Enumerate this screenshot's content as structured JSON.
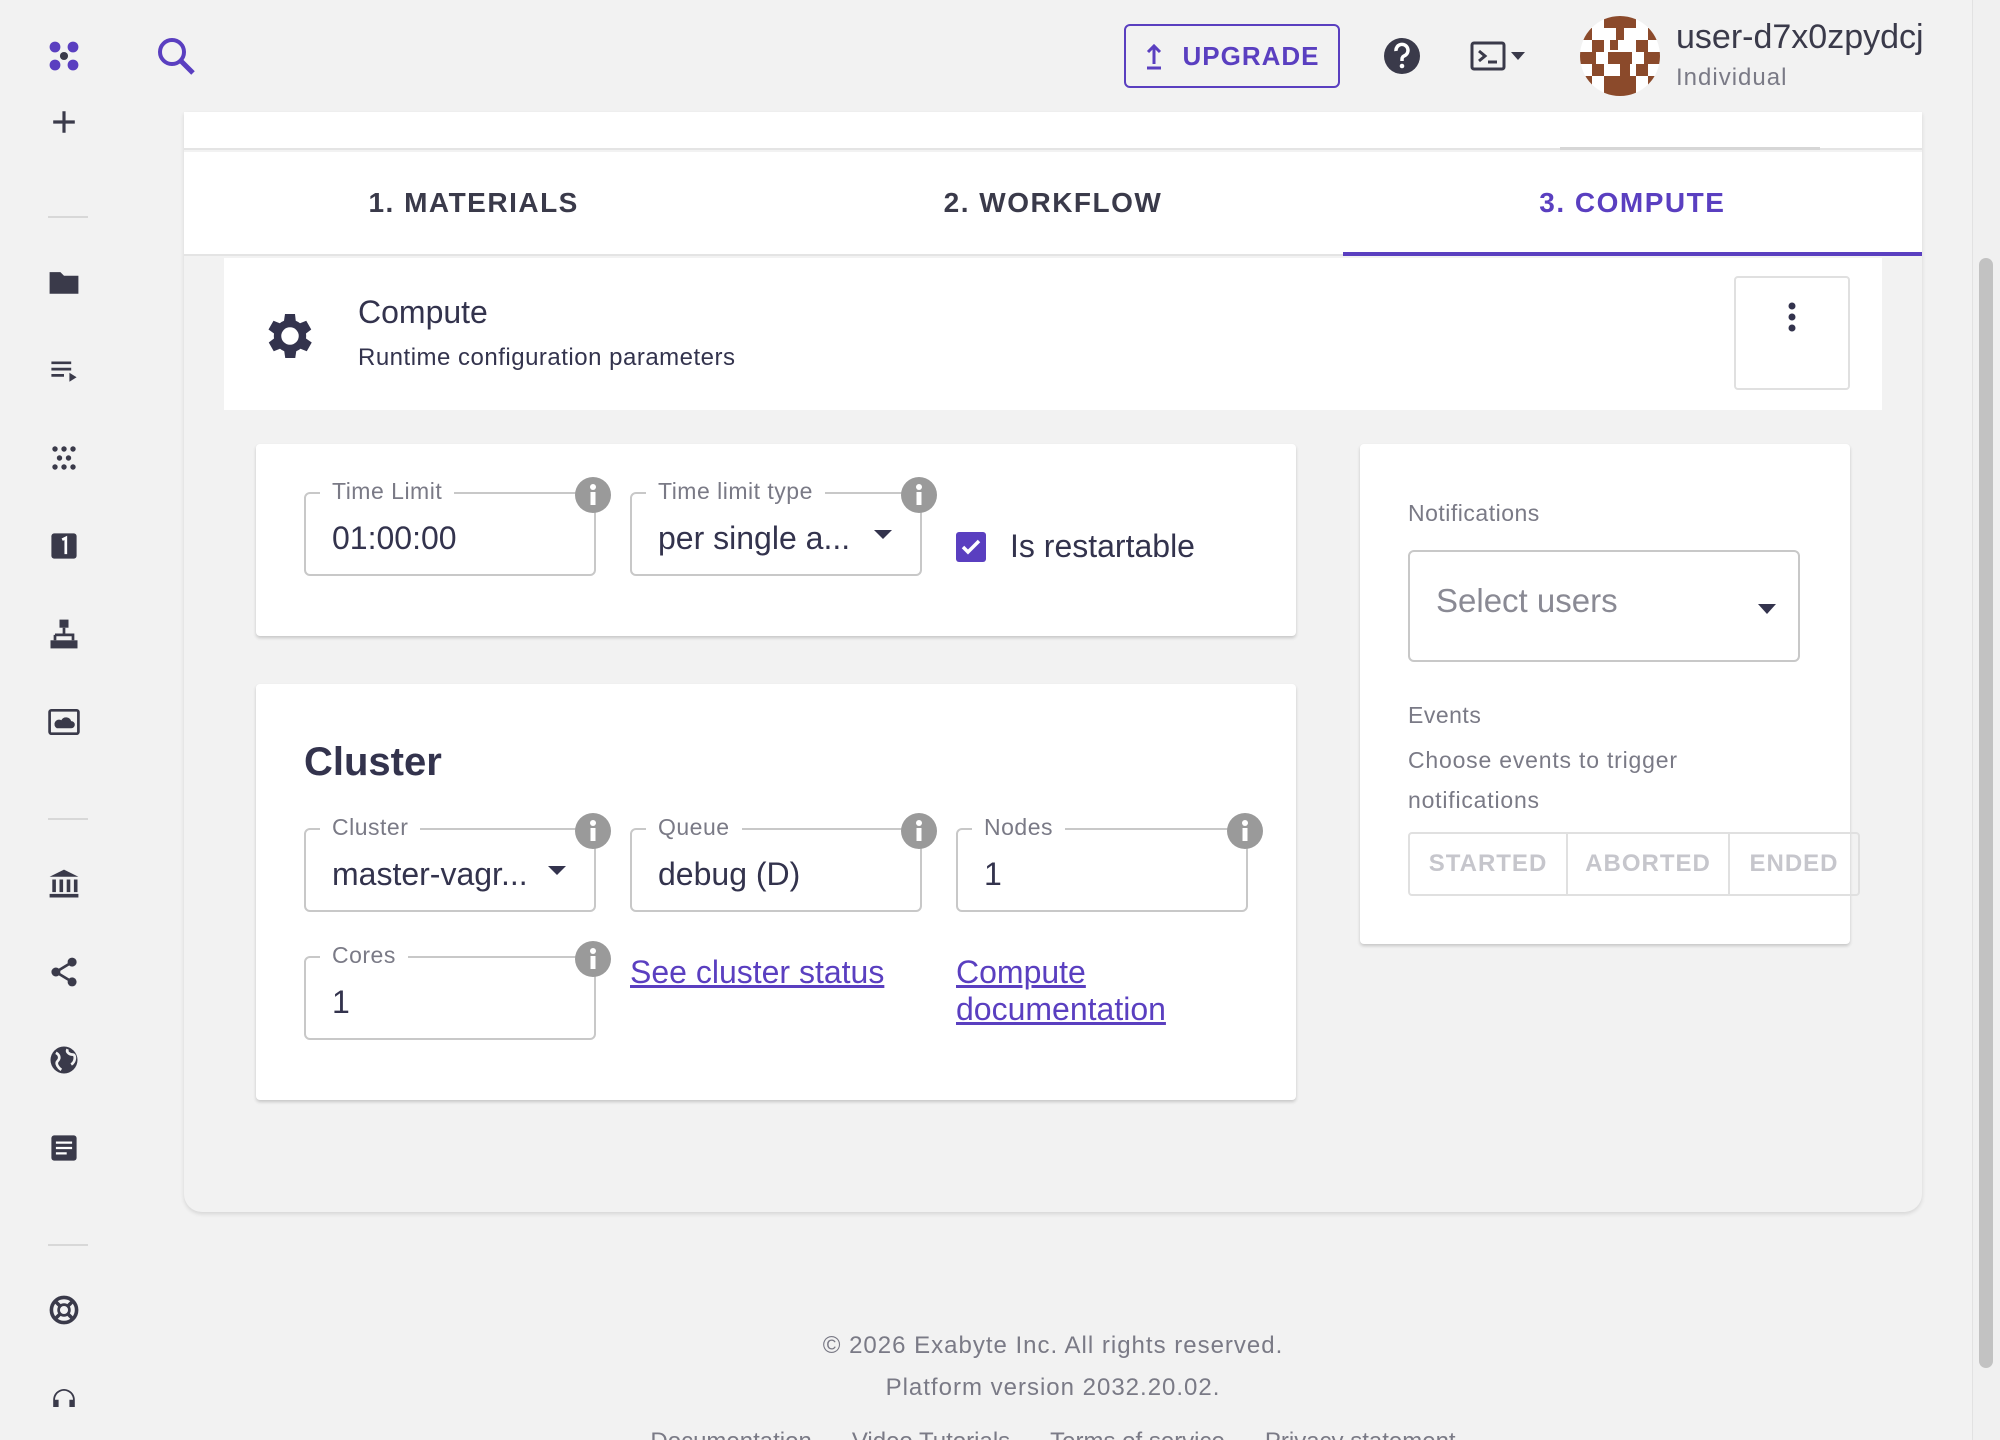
{
  "header": {
    "upgrade_label": "UPGRADE",
    "user_name": "user-d7x0zpydcj",
    "user_role": "Individual"
  },
  "tabs": [
    {
      "label": "1. MATERIALS",
      "active": false
    },
    {
      "label": "2. WORKFLOW",
      "active": false
    },
    {
      "label": "3. COMPUTE",
      "active": true
    }
  ],
  "compute": {
    "title": "Compute",
    "subtitle": "Runtime configuration parameters"
  },
  "time_panel": {
    "time_limit": {
      "label": "Time Limit",
      "value": "01:00:00"
    },
    "time_limit_type": {
      "label": "Time limit type",
      "value": "per single a..."
    },
    "is_restartable": {
      "label": "Is restartable",
      "checked": true
    }
  },
  "cluster_panel": {
    "title": "Cluster",
    "cluster": {
      "label": "Cluster",
      "value": "master-vagr..."
    },
    "queue": {
      "label": "Queue",
      "value": "debug (D)"
    },
    "nodes": {
      "label": "Nodes",
      "value": "1"
    },
    "cores": {
      "label": "Cores",
      "value": "1"
    },
    "see_cluster_status": "See cluster status",
    "compute_docs_line1": "Compute",
    "compute_docs_line2": "documentation"
  },
  "notifications": {
    "label": "Notifications",
    "select_placeholder": "Select users",
    "events_label": "Events",
    "events_desc": "Choose events to trigger notifications",
    "event_buttons": [
      "STARTED",
      "ABORTED",
      "ENDED"
    ]
  },
  "footer": {
    "copyright": "© 2026 Exabyte Inc. All rights reserved.",
    "version": "Platform version 2032.20.02.",
    "links": [
      "Documentation",
      "Video Tutorials",
      "Terms of service",
      "Privacy statement"
    ]
  },
  "colors": {
    "accent": "#5a3fc0",
    "text": "#33334d",
    "muted": "#7a7a86",
    "background": "#f2f2f2"
  },
  "icons": {
    "sidebar": [
      "logo-icon",
      "plus-icon",
      "folder-icon",
      "workflow-list-icon",
      "materials-icon",
      "jobs-icon",
      "hierarchy-icon",
      "cloud-monitor-icon",
      "bank-icon",
      "share-icon",
      "globe-icon",
      "notes-icon",
      "help-ring-icon",
      "support-icon"
    ]
  }
}
